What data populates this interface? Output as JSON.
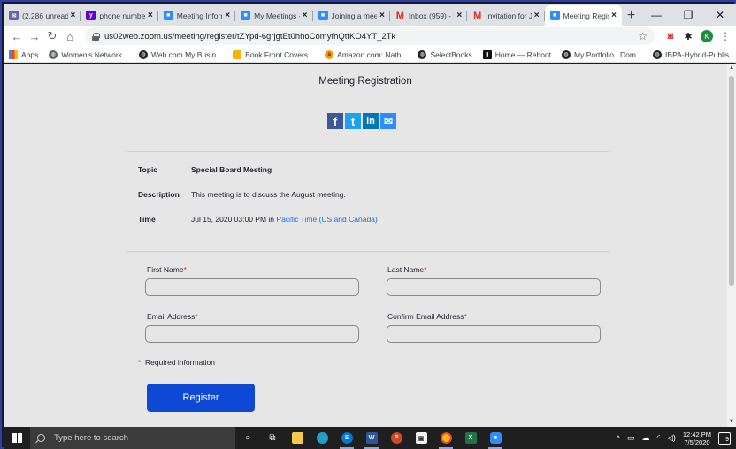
{
  "browser": {
    "tabs": [
      {
        "label": "(2,286 unread)",
        "icon": "mail-icon",
        "color": "#6264a7"
      },
      {
        "label": "phone number",
        "icon": "yahoo-icon",
        "color": "#6001d2"
      },
      {
        "label": "Meeting Inform",
        "icon": "zoom-icon",
        "color": "#2d8cff"
      },
      {
        "label": "My Meetings -",
        "icon": "zoom-icon",
        "color": "#2d8cff"
      },
      {
        "label": "Joining a meet",
        "icon": "zoom-icon",
        "color": "#2d8cff"
      },
      {
        "label": "Inbox (959) - k",
        "icon": "gmail-icon",
        "color": "#d93025"
      },
      {
        "label": "Invitation for J",
        "icon": "gmail-icon",
        "color": "#d93025"
      },
      {
        "label": "Meeting Regis",
        "icon": "zoom-icon",
        "color": "#2d8cff"
      }
    ],
    "url": "us02web.zoom.us/meeting/register/tZYpd-6grjgtEt0hhoComyfhQtfKO4YT_2Tk",
    "profile_initial": "K",
    "bookmarks": [
      {
        "label": "Apps",
        "icon": "apps-grid-icon"
      },
      {
        "label": "Women's Network...",
        "icon": "globe-icon"
      },
      {
        "label": "Web.com My Busin...",
        "icon": "globe-icon"
      },
      {
        "label": "Book Front Covers...",
        "icon": "bookmark-image-icon"
      },
      {
        "label": "Amazon.com: Nath...",
        "icon": "amazon-icon"
      },
      {
        "label": "SelectBooks",
        "icon": "globe-icon"
      },
      {
        "label": "Home — Reboot",
        "icon": "reboot-icon"
      },
      {
        "label": "My Portfolio : Dom...",
        "icon": "globe-icon"
      },
      {
        "label": "IBPA-Hybrid-Publis...",
        "icon": "globe-icon"
      }
    ],
    "bookmarks_more": "»"
  },
  "page": {
    "title": "Meeting Registration",
    "social": [
      {
        "glyph": "f",
        "icon": "facebook-icon",
        "color": "#3b5998"
      },
      {
        "glyph": "t",
        "icon": "twitter-icon",
        "color": "#1da1f2"
      },
      {
        "glyph": "in",
        "icon": "linkedin-icon",
        "color": "#0077b5"
      },
      {
        "glyph": "✉",
        "icon": "email-share-icon",
        "color": "#2d8cff"
      }
    ],
    "details": {
      "topic_label": "Topic",
      "topic_value": "Special Board Meeting",
      "description_label": "Description",
      "description_value": "This meeting is to discuss the August meeting.",
      "time_label": "Time",
      "time_value": "Jul 15, 2020 03:00 PM in ",
      "time_zone": "Pacific Time (US and Canada)"
    },
    "form": {
      "first_name_label": "First Name",
      "last_name_label": "Last Name",
      "email_label": "Email Address",
      "confirm_email_label": "Confirm Email Address",
      "required_mark": "*",
      "first_name_value": "",
      "last_name_value": "",
      "email_value": "",
      "confirm_email_value": "",
      "required_note": "Required information",
      "register_label": "Register"
    },
    "accent": "#0e49d6"
  },
  "taskbar": {
    "search_placeholder": "Type here to search",
    "time": "12:42 PM",
    "date": "7/5/2020",
    "notifications": "9"
  }
}
